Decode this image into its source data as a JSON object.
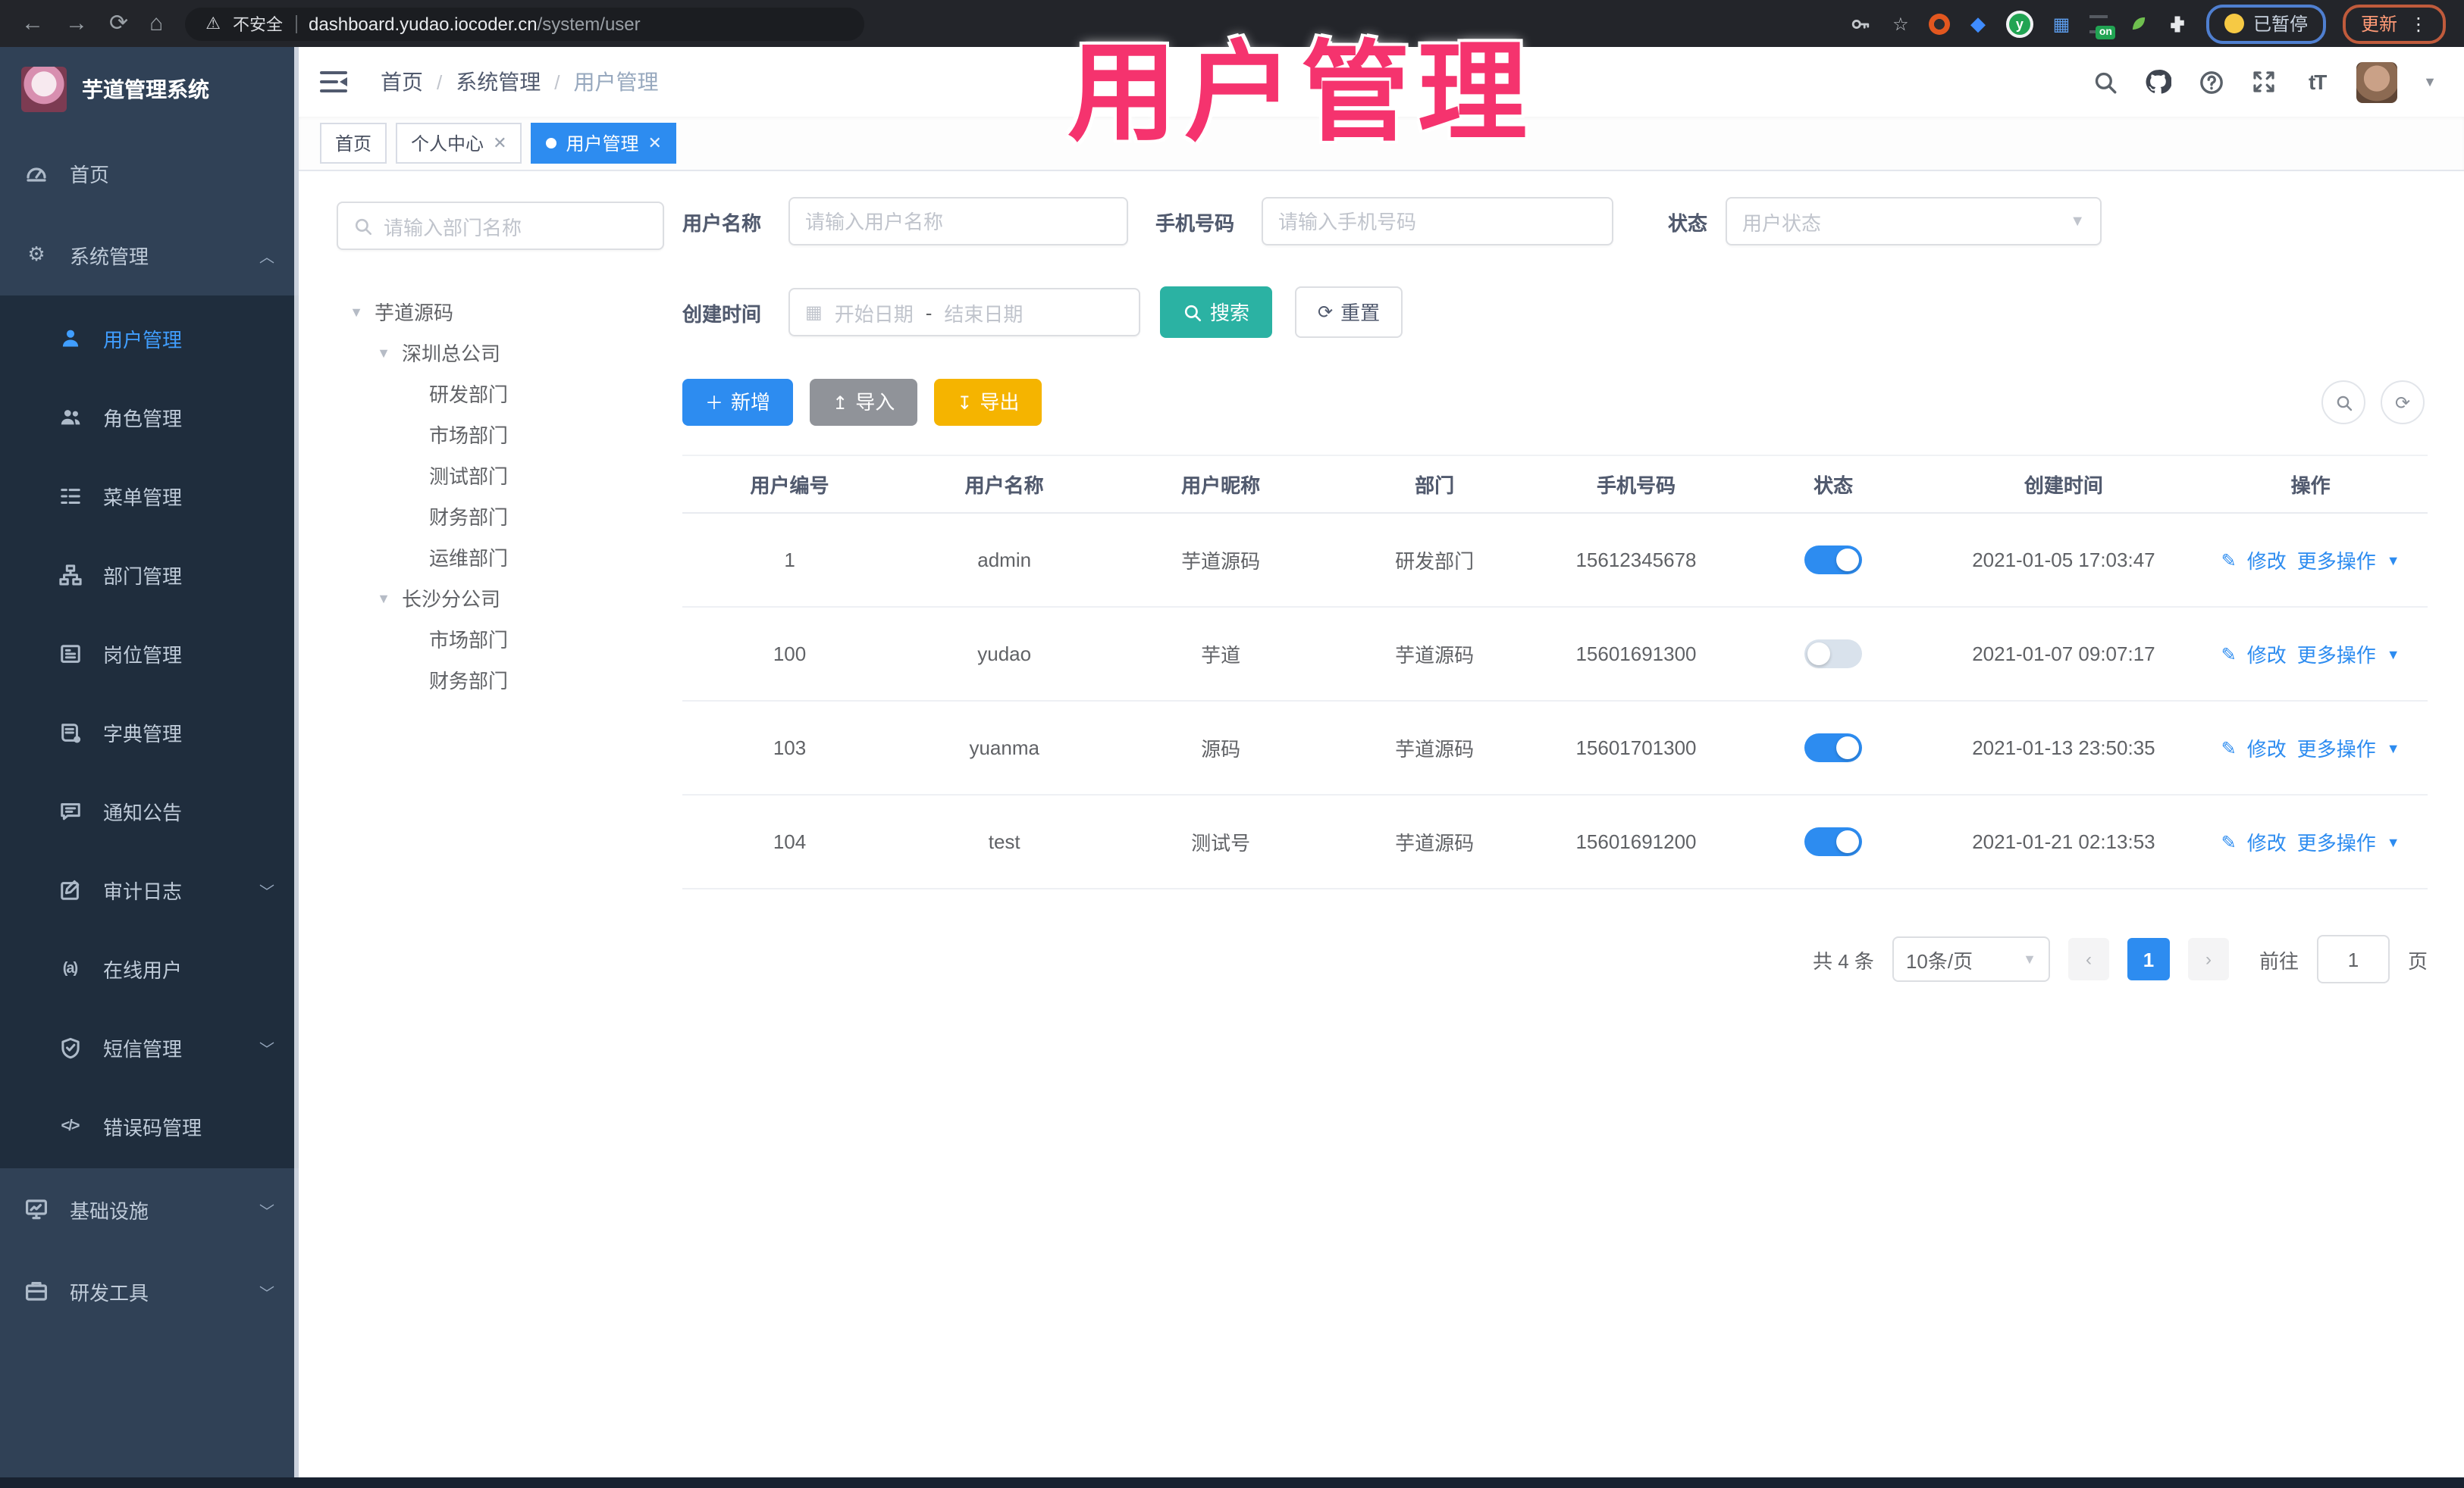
{
  "watermark": "用户管理",
  "browser": {
    "security_label": "不安全",
    "url_domain": "dashboard.yudao.iocoder.cn",
    "url_path": "/system/user",
    "on_badge": "on",
    "profile_badge": "已暂停",
    "update_label": "更新"
  },
  "app": {
    "logo_title": "芋道管理系统",
    "breadcrumb": [
      "首页",
      "系统管理",
      "用户管理"
    ],
    "font_size_icon_label": "tT"
  },
  "tabs": [
    {
      "label": "首页"
    },
    {
      "label": "个人中心"
    },
    {
      "label": "用户管理"
    }
  ],
  "sidebar": {
    "items": [
      {
        "label": "首页"
      },
      {
        "label": "系统管理"
      },
      {
        "label": "用户管理"
      },
      {
        "label": "角色管理"
      },
      {
        "label": "菜单管理"
      },
      {
        "label": "部门管理"
      },
      {
        "label": "岗位管理"
      },
      {
        "label": "字典管理"
      },
      {
        "label": "通知公告"
      },
      {
        "label": "审计日志"
      },
      {
        "label": "在线用户"
      },
      {
        "label": "短信管理"
      },
      {
        "label": "错误码管理"
      },
      {
        "label": "基础设施"
      },
      {
        "label": "研发工具"
      }
    ],
    "online_icon_label": "(a)",
    "code_icon_label": "</>"
  },
  "tree": {
    "search_placeholder": "请输入部门名称",
    "nodes": [
      "芋道源码",
      "深圳总公司",
      "研发部门",
      "市场部门",
      "测试部门",
      "财务部门",
      "运维部门",
      "长沙分公司",
      "市场部门",
      "财务部门"
    ]
  },
  "filters": {
    "username_label": "用户名称",
    "username_placeholder": "请输入用户名称",
    "mobile_label": "手机号码",
    "mobile_placeholder": "请输入手机号码",
    "status_label": "状态",
    "status_placeholder": "用户状态",
    "created_label": "创建时间",
    "start_placeholder": "开始日期",
    "range_separator": "-",
    "end_placeholder": "结束日期",
    "search_label": "搜索",
    "reset_label": "重置"
  },
  "toolbar": {
    "add_label": "新增",
    "import_label": "导入",
    "export_label": "导出"
  },
  "table": {
    "columns": [
      "用户编号",
      "用户名称",
      "用户昵称",
      "部门",
      "手机号码",
      "状态",
      "创建时间",
      "操作"
    ],
    "edit_label": "修改",
    "more_label": "更多操作",
    "rows": [
      {
        "id": "1",
        "username": "admin",
        "nickname": "芋道源码",
        "dept": "研发部门",
        "mobile": "15612345678",
        "status_on": true,
        "created": "2021-01-05 17:03:47"
      },
      {
        "id": "100",
        "username": "yudao",
        "nickname": "芋道",
        "dept": "芋道源码",
        "mobile": "15601691300",
        "status_on": false,
        "created": "2021-01-07 09:07:17"
      },
      {
        "id": "103",
        "username": "yuanma",
        "nickname": "源码",
        "dept": "芋道源码",
        "mobile": "15601701300",
        "status_on": true,
        "created": "2021-01-13 23:50:35"
      },
      {
        "id": "104",
        "username": "test",
        "nickname": "测试号",
        "dept": "芋道源码",
        "mobile": "15601691200",
        "status_on": true,
        "created": "2021-01-21 02:13:53"
      }
    ]
  },
  "pagination": {
    "total_label": "共 4 条",
    "page_size_label": "10条/页",
    "current_page": "1",
    "goto_label": "前往",
    "goto_value": "1",
    "page_unit_label": "页"
  },
  "colors": {
    "accent_blue": "#2d8cf0",
    "active_menu_blue": "#409eff",
    "search_teal": "#2bb2a3",
    "export_yellow": "#f5b400",
    "import_gray": "#909399",
    "watermark_pink": "#f5336e",
    "sidebar_bg": "#304156",
    "submenu_bg": "#1f2d3d"
  }
}
